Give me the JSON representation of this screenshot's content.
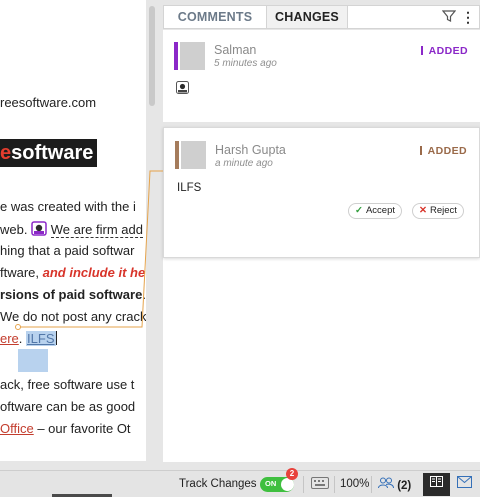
{
  "document": {
    "line_url": "reesoftware.com",
    "banner_left": "e",
    "banner_right": "software",
    "line1": "e was created with the i",
    "line2_a": "web.",
    "line2_b": "We are firm add",
    "line3": "hing that a paid softwar",
    "line4_a": "ftware, ",
    "line4_b": "and include it he",
    "line5_a": "rsions of paid software",
    "line5_b": ".",
    "line6": "We do not post any crack",
    "line7_a": "ere",
    "line7_b": ". ",
    "line7_c": "ILFS",
    "line8": "ack, free software use t",
    "line9": "oftware can be as good",
    "line10_a": "Office",
    "line10_b": " – our favorite Ot"
  },
  "panel": {
    "tabs": [
      {
        "label": "COMMENTS",
        "active": false
      },
      {
        "label": "CHANGES",
        "active": true
      }
    ],
    "filter_icon": "filter-icon",
    "more_icon": "kebab-menu-icon",
    "changes": [
      {
        "author": "Salman",
        "time": "5 minutes ago",
        "status": "ADDED",
        "status_color": "#8b28c8",
        "avatar_color": "#8b28c8",
        "content": "image-icon"
      },
      {
        "author": "Harsh Gupta",
        "time": "a minute ago",
        "status": "ADDED",
        "status_color": "#9a6a4a",
        "avatar_color": "#a57c5c",
        "content": "ILFS",
        "accept_label": "Accept",
        "reject_label": "Reject"
      }
    ]
  },
  "statusbar": {
    "track_changes_label": "Track Changes",
    "toggle_state": "ON",
    "badge_count": "2",
    "zoom": "100%",
    "users": "(2)",
    "accent": "#3fbf3f"
  }
}
